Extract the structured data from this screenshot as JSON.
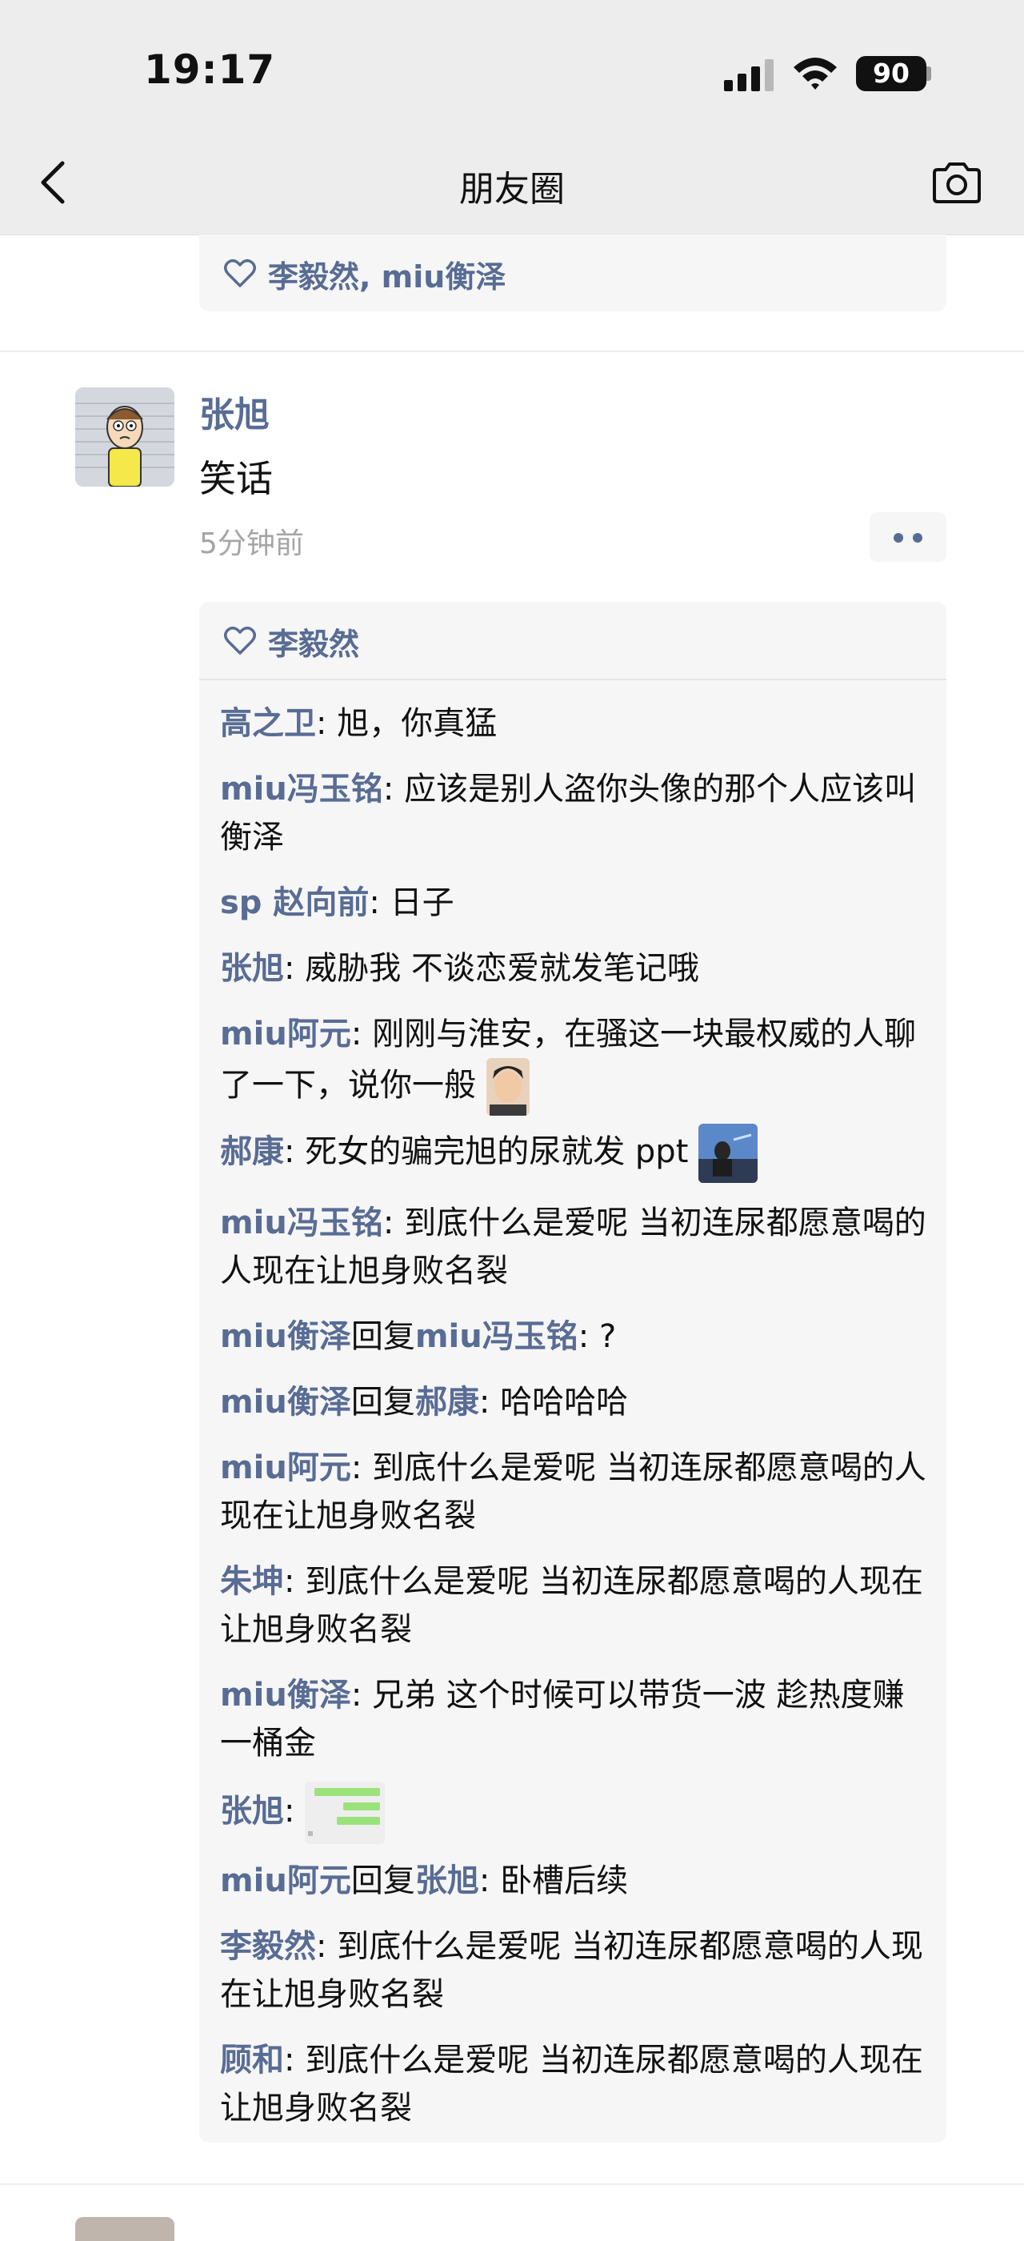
{
  "status_bar": {
    "time": "19:17",
    "battery": "90"
  },
  "nav": {
    "title": "朋友圈"
  },
  "prev_post": {
    "likes": "李毅然, miu衡泽"
  },
  "post": {
    "author": "张旭",
    "text": "笑话",
    "time": "5分钟前",
    "likes": "李毅然",
    "comments": [
      {
        "name": "高之卫",
        "sep": ": ",
        "text": "旭，你真猛"
      },
      {
        "name": "miu冯玉铭",
        "sep": ": ",
        "text": "应该是别人盗你头像的那个人应该叫衡泽"
      },
      {
        "name": "sp 赵向前",
        "sep": ": ",
        "text": "日子"
      },
      {
        "name": "张旭",
        "sep": ": ",
        "text": "威胁我 不谈恋爱就发笔记哦"
      },
      {
        "name": "miu阿元",
        "sep": ": ",
        "text": "刚刚与淮安，在骚这一块最权威的人聊了一下，说你一般"
      },
      {
        "name": "郝康",
        "sep": ": ",
        "text": "死女的骗完旭的尿就发 ppt"
      },
      {
        "name": "miu冯玉铭",
        "sep": ": ",
        "text": "到底什么是爱呢 当初连尿都愿意喝的人现在让旭身败名裂"
      },
      {
        "name": "miu衡泽",
        "reply_word": "回复",
        "reply_to": "miu冯玉铭",
        "sep": ": ",
        "text": "?"
      },
      {
        "name": "miu衡泽",
        "reply_word": "回复",
        "reply_to": "郝康",
        "sep": ": ",
        "text": "哈哈哈哈"
      },
      {
        "name": "miu阿元",
        "sep": ": ",
        "text": "到底什么是爱呢 当初连尿都愿意喝的人现在让旭身败名裂"
      },
      {
        "name": "朱坤",
        "sep": ": ",
        "text": "到底什么是爱呢 当初连尿都愿意喝的人现在让旭身败名裂"
      },
      {
        "name": "miu衡泽",
        "sep": ": ",
        "text": "兄弟 这个时候可以带货一波 趁热度赚一桶金"
      },
      {
        "name": "张旭",
        "sep": ": ",
        "text": ""
      },
      {
        "name": "miu阿元",
        "reply_word": "回复",
        "reply_to": "张旭",
        "sep": ": ",
        "text": "卧槽后续"
      },
      {
        "name": "李毅然",
        "sep": ": ",
        "text": "到底什么是爱呢 当初连尿都愿意喝的人现在让旭身败名裂"
      },
      {
        "name": "顾和",
        "sep": ": ",
        "text": "到底什么是爱呢 当初连尿都愿意喝的人现在让旭身败名裂"
      }
    ]
  },
  "icons": {
    "back": "chevron-left-icon",
    "camera": "camera-icon",
    "like": "heart-outline-icon",
    "more": "more-dots-icon"
  },
  "colors": {
    "name_link": "#586c94",
    "panel_bg": "#f6f6f6",
    "header_bg": "#ededed"
  }
}
